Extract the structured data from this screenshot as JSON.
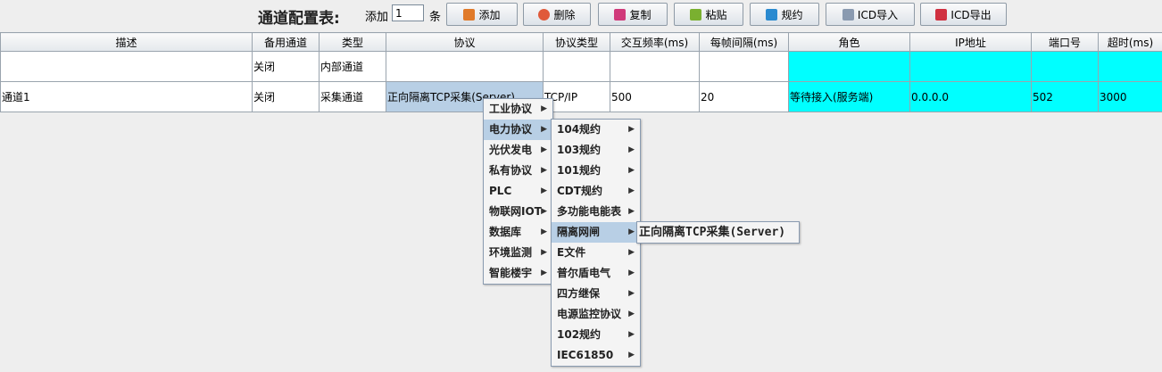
{
  "toolbar": {
    "title": "通道配置表:",
    "add_label": "添加",
    "count_value": "1",
    "unit": "条",
    "buttons": [
      "添加",
      "删除",
      "复制",
      "粘贴",
      "规约",
      "ICD导入",
      "ICD导出"
    ]
  },
  "table": {
    "headers": [
      "描述",
      "备用通道",
      "类型",
      "协议",
      "协议类型",
      "交互频率(ms)",
      "每帧间隔(ms)",
      "角色",
      "IP地址",
      "端口号",
      "超时(ms)"
    ],
    "rows": [
      [
        "",
        "关闭",
        "内部通道",
        "",
        "",
        "",
        "",
        "",
        "",
        "",
        ""
      ],
      [
        "通道1",
        "关闭",
        "采集通道",
        "正向隔离TCP采集(Server)",
        "TCP/IP",
        "500",
        "20",
        "等待接入(服务端)",
        "0.0.0.0",
        "502",
        "3000"
      ]
    ]
  },
  "menu_level1": [
    "工业协议",
    "电力协议",
    "光伏发电",
    "私有协议",
    "PLC",
    "物联网IOT",
    "数据库",
    "环境监测",
    "智能楼宇"
  ],
  "menu_level2": [
    "104规约",
    "103规约",
    "101规约",
    "CDT规约",
    "多功能电能表",
    "隔离网闸",
    "E文件",
    "普尔盾电气",
    "四方继保",
    "电源监控协议",
    "102规约",
    "IEC61850"
  ],
  "menu_level3": [
    "正向隔离TCP采集(Server)"
  ],
  "colors": {
    "highlight": "#00ffff",
    "selection": "#b8cfe5"
  }
}
